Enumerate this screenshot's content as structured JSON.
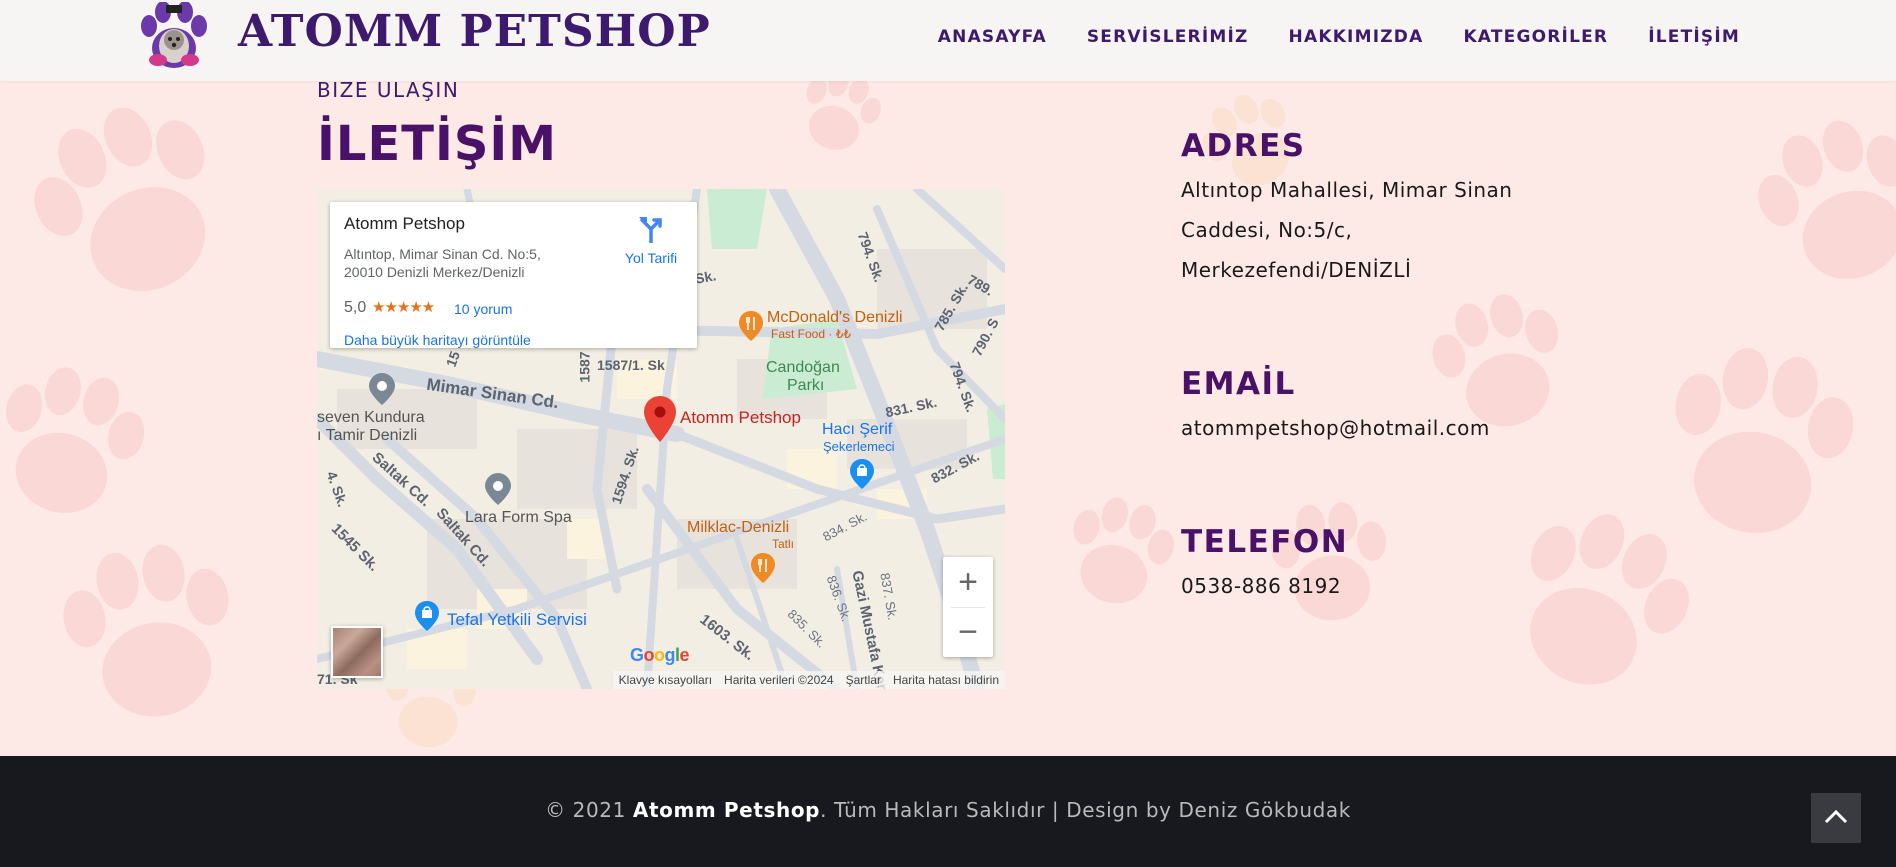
{
  "header": {
    "brand": "ATOMM PETSHOP",
    "nav": [
      "ANASAYFA",
      "SERVİSLERİMİZ",
      "HAKKIMIZDA",
      "KATEGORİLER",
      "İLETİŞİM"
    ]
  },
  "section": {
    "eyebrow": "BIZE ULAŞIN",
    "title": "İLETİŞİM"
  },
  "map": {
    "card": {
      "name": "Atomm Petshop",
      "address": "Altıntop, Mimar Sinan Cd. No:5, 20010 Denizli Merkez/Denizli",
      "rating": "5,0",
      "stars": "★★★★★",
      "reviews": "10 yorum",
      "larger_map": "Daha büyük haritayı görüntüle",
      "directions": "Yol Tarifi"
    },
    "labels": {
      "marker": "Atomm Petshop",
      "mcdonalds": "McDonald's Denizli",
      "mcdonalds_sub": "Fast Food · ₺₺",
      "park1": "Candoğan",
      "park2": "Parkı",
      "haci1": "Hacı Şerif",
      "haci2": "Şekerlemeci",
      "milklac": "Milklac-Denizli",
      "milklac_sub": "Tatlı",
      "lara": "Lara Form Spa",
      "tefal": "Tefal Yetkili Servisi",
      "kundura1": "seven Kundura",
      "kundura2": "ı Tamir Denizli",
      "mimar": "Mimar Sinan Cd.",
      "saltak1": "Saltak Cd.",
      "saltak2": "Saltak Cd.",
      "gazi": "Gazi Mustafa Kemal B.",
      "s1587_1": "1587/1. Sk",
      "s1587": "1587",
      "s1594": "1594. Sk.",
      "s1545": "1545 Sk.",
      "s1603": "1603. Sk.",
      "s794a": "794. Sk.",
      "s794b": "794. Sk.",
      "s785": "785. Sk.",
      "s789": "789.",
      "s790": "790. S",
      "s831": "831. Sk.",
      "s832": "832. Sk.",
      "s834": "834. Sk.",
      "s835": "835. Sk.",
      "s836": "836. Sk.",
      "s837": "837. Sk.",
      "s15": "15",
      "s71": "71. Sk",
      "s4": "4. Sk.",
      "sk": "Sk.",
      "google": "Google"
    },
    "attribution": [
      "Klavye kısayolları",
      "Harita verileri ©2024",
      "Şartlar",
      "Harita hatası bildirin"
    ]
  },
  "contact": {
    "address_heading": "ADRES",
    "address_lines": [
      "Altıntop Mahallesi, Mimar Sinan",
      "Caddesi, No:5/c,",
      "Merkezefendi/DENİZLİ"
    ],
    "email_heading": "EMAİL",
    "email": "atommpetshop@hotmail.com",
    "phone_heading": "TELEFON",
    "phone": "0538-886 8192"
  },
  "footer": {
    "prefix": "© 2021 ",
    "brand": "Atomm Petshop",
    "suffix": ". Tüm Hakları Saklıdır | Design by Deniz Gökbudak"
  },
  "colors": {
    "accent": "#4a1168",
    "nav": "#3e1a6e",
    "page_bg": "#fdeae6",
    "footer_bg": "#18191e"
  },
  "icons": [
    "logo-icon",
    "directions-icon",
    "map-marker-icon",
    "restaurant-icon",
    "shopping-icon",
    "place-icon",
    "zoom-in-icon",
    "zoom-out-icon",
    "chevron-up-icon"
  ]
}
